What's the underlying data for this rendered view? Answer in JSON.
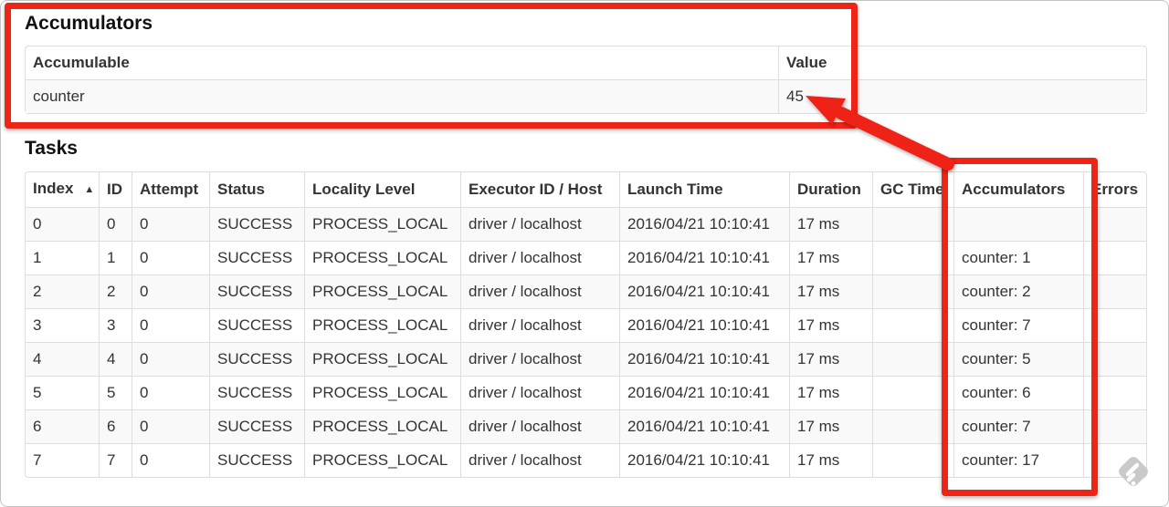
{
  "accumulators_section": {
    "title": "Accumulators",
    "table": {
      "headers": [
        "Accumulable",
        "Value"
      ],
      "rows": [
        [
          "counter",
          "45"
        ]
      ]
    }
  },
  "tasks_section": {
    "title": "Tasks",
    "table": {
      "sort": {
        "column": "Index",
        "icon": "▲",
        "direction": "ascending"
      },
      "headers": [
        "Index",
        "ID",
        "Attempt",
        "Status",
        "Locality Level",
        "Executor ID / Host",
        "Launch Time",
        "Duration",
        "GC Time",
        "Accumulators",
        "Errors"
      ],
      "rows": [
        [
          "0",
          "0",
          "0",
          "SUCCESS",
          "PROCESS_LOCAL",
          "driver / localhost",
          "2016/04/21 10:10:41",
          "17 ms",
          "",
          "",
          ""
        ],
        [
          "1",
          "1",
          "0",
          "SUCCESS",
          "PROCESS_LOCAL",
          "driver / localhost",
          "2016/04/21 10:10:41",
          "17 ms",
          "",
          "counter: 1",
          ""
        ],
        [
          "2",
          "2",
          "0",
          "SUCCESS",
          "PROCESS_LOCAL",
          "driver / localhost",
          "2016/04/21 10:10:41",
          "17 ms",
          "",
          "counter: 2",
          ""
        ],
        [
          "3",
          "3",
          "0",
          "SUCCESS",
          "PROCESS_LOCAL",
          "driver / localhost",
          "2016/04/21 10:10:41",
          "17 ms",
          "",
          "counter: 7",
          ""
        ],
        [
          "4",
          "4",
          "0",
          "SUCCESS",
          "PROCESS_LOCAL",
          "driver / localhost",
          "2016/04/21 10:10:41",
          "17 ms",
          "",
          "counter: 5",
          ""
        ],
        [
          "5",
          "5",
          "0",
          "SUCCESS",
          "PROCESS_LOCAL",
          "driver / localhost",
          "2016/04/21 10:10:41",
          "17 ms",
          "",
          "counter: 6",
          ""
        ],
        [
          "6",
          "6",
          "0",
          "SUCCESS",
          "PROCESS_LOCAL",
          "driver / localhost",
          "2016/04/21 10:10:41",
          "17 ms",
          "",
          "counter: 7",
          ""
        ],
        [
          "7",
          "7",
          "0",
          "SUCCESS",
          "PROCESS_LOCAL",
          "driver / localhost",
          "2016/04/21 10:10:41",
          "17 ms",
          "",
          "counter: 17",
          ""
        ]
      ]
    }
  },
  "annotations": {
    "color": "#ee2417",
    "arrow_points_to": "45"
  }
}
